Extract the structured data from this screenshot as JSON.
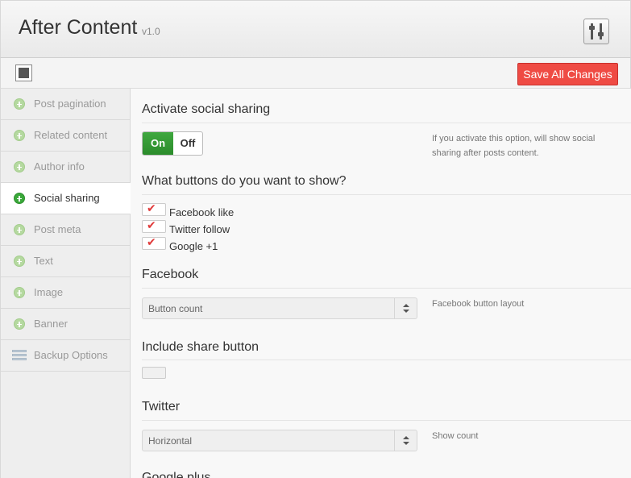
{
  "header": {
    "title": "After Content",
    "version": "v1.0",
    "settings_icon": "sliders-icon"
  },
  "toolbar": {
    "collapse_icon": "collapse-square-icon",
    "save_label": "Save All Changes",
    "save_color": "#ef4b44"
  },
  "sidebar": {
    "items": [
      {
        "label": "Post pagination",
        "icon": "plus-circle-icon",
        "active": false
      },
      {
        "label": "Related content",
        "icon": "plus-circle-icon",
        "active": false
      },
      {
        "label": "Author info",
        "icon": "plus-circle-icon",
        "active": false
      },
      {
        "label": "Social sharing",
        "icon": "plus-circle-icon",
        "active": true
      },
      {
        "label": "Post meta",
        "icon": "plus-circle-icon",
        "active": false
      },
      {
        "label": "Text",
        "icon": "plus-circle-icon",
        "active": false
      },
      {
        "label": "Image",
        "icon": "plus-circle-icon",
        "active": false
      },
      {
        "label": "Banner",
        "icon": "plus-circle-icon",
        "active": false
      },
      {
        "label": "Backup Options",
        "icon": "backup-icon",
        "active": false
      }
    ]
  },
  "main": {
    "activate": {
      "title": "Activate social sharing",
      "on_label": "On",
      "off_label": "Off",
      "state": "on",
      "description": "If you activate this option, will show social sharing after posts content."
    },
    "buttons": {
      "title": "What buttons do you want to show?",
      "options": [
        {
          "label": "Facebook like",
          "checked": true
        },
        {
          "label": "Twitter follow",
          "checked": true
        },
        {
          "label": "Google +1",
          "checked": true
        }
      ]
    },
    "facebook": {
      "title": "Facebook",
      "select_value": "Button count",
      "description": "Facebook button layout"
    },
    "share": {
      "title": "Include share button",
      "checked": false
    },
    "twitter": {
      "title": "Twitter",
      "select_value": "Horizontal",
      "description": "Show count"
    },
    "google": {
      "title": "Google plus"
    }
  }
}
